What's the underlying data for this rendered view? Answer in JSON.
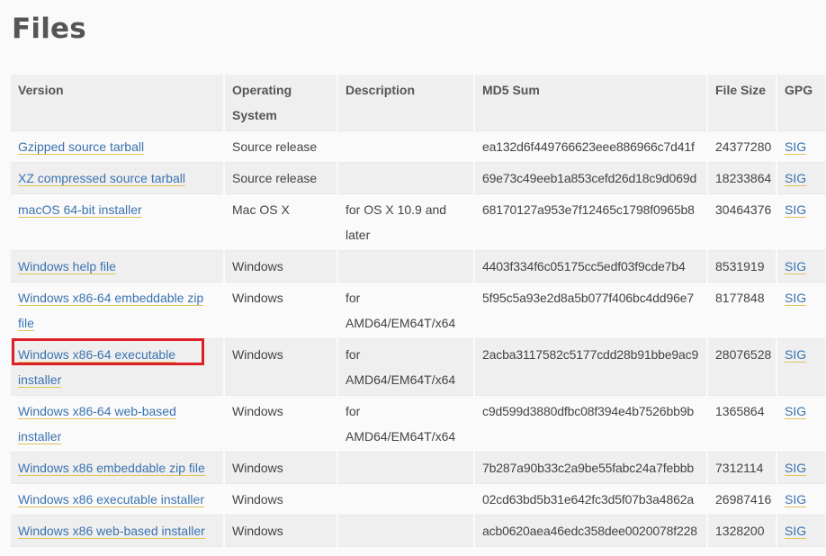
{
  "page": {
    "title": "Files"
  },
  "table": {
    "headers": {
      "version": "Version",
      "os": "Operating System",
      "description": "Description",
      "md5": "MD5 Sum",
      "size": "File Size",
      "gpg": "GPG"
    },
    "rows": [
      {
        "version": "Gzipped source tarball",
        "os": "Source release",
        "description": "",
        "md5": "ea132d6f449766623eee886966c7d41f",
        "size": "24377280",
        "gpg": "SIG"
      },
      {
        "version": "XZ compressed source tarball",
        "os": "Source release",
        "description": "",
        "md5": "69e73c49eeb1a853cefd26d18c9d069d",
        "size": "18233864",
        "gpg": "SIG"
      },
      {
        "version": "macOS 64-bit installer",
        "os": "Mac OS X",
        "description": "for OS X 10.9 and later",
        "md5": "68170127a953e7f12465c1798f0965b8",
        "size": "30464376",
        "gpg": "SIG"
      },
      {
        "version": "Windows help file",
        "os": "Windows",
        "description": "",
        "md5": "4403f334f6c05175cc5edf03f9cde7b4",
        "size": "8531919",
        "gpg": "SIG"
      },
      {
        "version": "Windows x86-64 embeddable zip file",
        "os": "Windows",
        "description": "for AMD64/EM64T/x64",
        "md5": "5f95c5a93e2d8a5b077f406bc4dd96e7",
        "size": "8177848",
        "gpg": "SIG"
      },
      {
        "version": "Windows x86-64 executable installer",
        "os": "Windows",
        "description": "for AMD64/EM64T/x64",
        "md5": "2acba3117582c5177cdd28b91bbe9ac9",
        "size": "28076528",
        "gpg": "SIG"
      },
      {
        "version": "Windows x86-64 web-based installer",
        "os": "Windows",
        "description": "for AMD64/EM64T/x64",
        "md5": "c9d599d3880dfbc08f394e4b7526bb9b",
        "size": "1365864",
        "gpg": "SIG"
      },
      {
        "version": "Windows x86 embeddable zip file",
        "os": "Windows",
        "description": "",
        "md5": "7b287a90b33c2a9be55fabc24a7febbb",
        "size": "7312114",
        "gpg": "SIG"
      },
      {
        "version": "Windows x86 executable installer",
        "os": "Windows",
        "description": "",
        "md5": "02cd63bd5b31e642fc3d5f07b3a4862a",
        "size": "26987416",
        "gpg": "SIG"
      },
      {
        "version": "Windows x86 web-based installer",
        "os": "Windows",
        "description": "",
        "md5": "acb0620aea46edc358dee0020078f228",
        "size": "1328200",
        "gpg": "SIG"
      }
    ]
  },
  "colors": {
    "link": "#3b73b0",
    "link_underline": "#e0c458",
    "highlight": "#dd1f27",
    "row_alt": "#efefef",
    "background": "#fafafa"
  }
}
